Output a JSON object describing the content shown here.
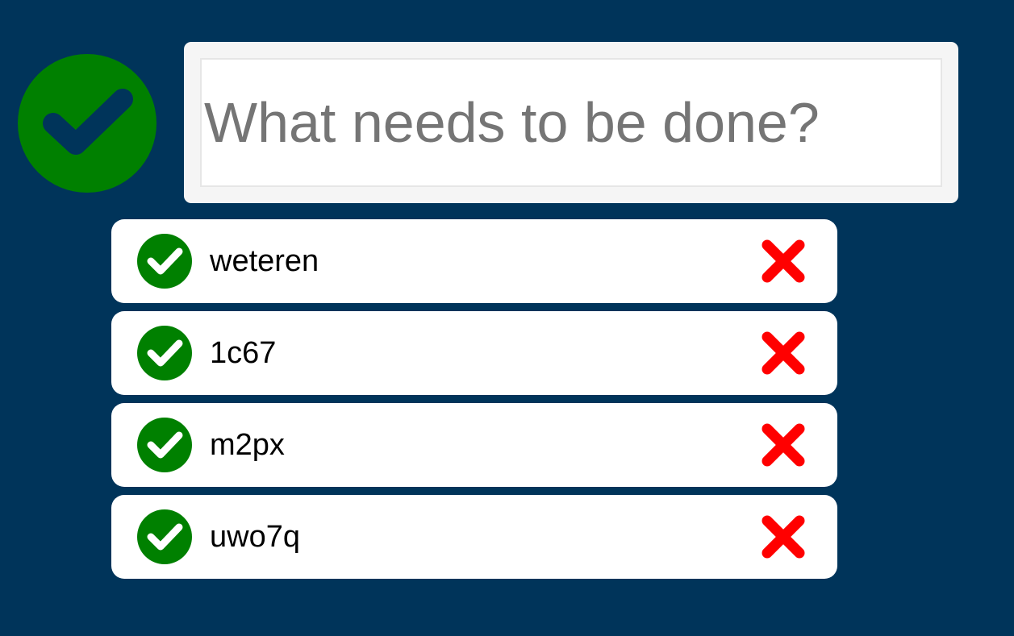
{
  "colors": {
    "background": "#00345a",
    "complete_green": "#008000",
    "check_dark": "#00345a",
    "check_white": "#ffffff",
    "delete_red": "#ff0000",
    "input_frame": "#f5f5f5",
    "placeholder": "#757575"
  },
  "header": {
    "toggle_all_icon": "check-circle-icon",
    "new_todo": {
      "value": "",
      "placeholder": "What needs to be done?"
    }
  },
  "todos": [
    {
      "label": "weteren",
      "completed": true
    },
    {
      "label": "1c67",
      "completed": true
    },
    {
      "label": "m2px",
      "completed": true
    },
    {
      "label": "uwo7q",
      "completed": true
    }
  ],
  "icons": {
    "complete": "check-circle-icon",
    "delete": "x-icon"
  }
}
